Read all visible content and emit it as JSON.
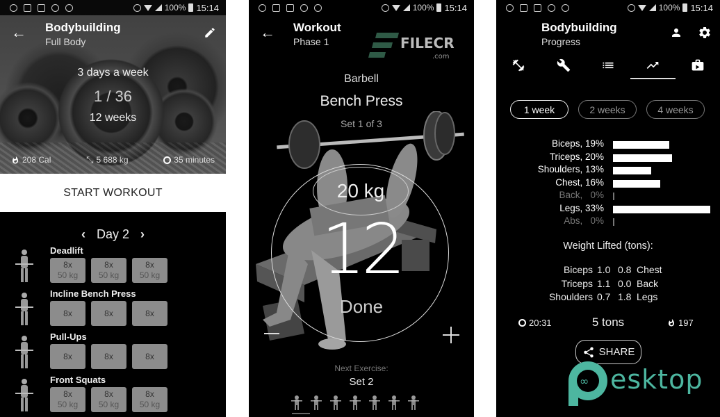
{
  "status_bar": {
    "battery": "100%",
    "time": "15:14"
  },
  "panel_overview": {
    "title": "Bodybuilding",
    "subtitle": "Full Body",
    "frequency": "3 days a week",
    "progress": "1 / 36",
    "duration": "12 weeks",
    "stats": {
      "calories": "208 Cal",
      "weight": "5 688 kg",
      "time": "35 minutes"
    },
    "start_label": "START WORKOUT",
    "day_label": "Day 2",
    "exercises": [
      {
        "name": "Deadlift",
        "sets": [
          {
            "reps": "8x",
            "weight": "50 kg"
          },
          {
            "reps": "8x",
            "weight": "50 kg"
          },
          {
            "reps": "8x",
            "weight": "50 kg"
          }
        ]
      },
      {
        "name": "Incline Bench Press",
        "sets": [
          {
            "reps": "8x",
            "weight": ""
          },
          {
            "reps": "8x",
            "weight": ""
          },
          {
            "reps": "8x",
            "weight": ""
          }
        ]
      },
      {
        "name": "Pull-Ups",
        "sets": [
          {
            "reps": "8x",
            "weight": ""
          },
          {
            "reps": "8x",
            "weight": ""
          },
          {
            "reps": "8x",
            "weight": ""
          }
        ]
      },
      {
        "name": "Front Squats",
        "sets": [
          {
            "reps": "8x",
            "weight": "50 kg"
          },
          {
            "reps": "8x",
            "weight": "50 kg"
          },
          {
            "reps": "8x",
            "weight": "50 kg"
          }
        ]
      }
    ]
  },
  "panel_workout": {
    "title": "Workout",
    "subtitle": "Phase 1",
    "watermark": "FILECR",
    "watermark_sub": ".com",
    "equipment": "Barbell",
    "exercise": "Bench Press",
    "set_info": "Set 1 of 3",
    "weight": "20 kg",
    "reps": "12",
    "done_label": "Done",
    "next_label": "Next Exercise:",
    "next_value": "Set 2",
    "strip_count": 7
  },
  "panel_progress": {
    "title": "Bodybuilding",
    "subtitle": "Progress",
    "tabs": [
      "exercises-icon",
      "tools-icon",
      "list-icon",
      "trending-icon",
      "store-icon"
    ],
    "active_tab": 3,
    "ranges": [
      {
        "label": "1 week",
        "active": true
      },
      {
        "label": "2 weeks",
        "active": false
      },
      {
        "label": "4 weeks",
        "active": false
      }
    ],
    "muscle_split": [
      {
        "label": "Biceps, 19%",
        "value": 19
      },
      {
        "label": "Triceps, 20%",
        "value": 20
      },
      {
        "label": "Shoulders, 13%",
        "value": 13
      },
      {
        "label": "Chest, 16%",
        "value": 16
      },
      {
        "label": "Back,   0%",
        "value": 0
      },
      {
        "label": "Legs, 33%",
        "value": 33
      },
      {
        "label": "Abs,   0%",
        "value": 0
      }
    ],
    "weight_title": "Weight Lifted (tons):",
    "weight_rows": [
      {
        "left_name": "Biceps",
        "left_val": "1.0",
        "right_val": "0.8",
        "right_name": "Chest"
      },
      {
        "left_name": "Triceps",
        "left_val": "1.1",
        "right_val": "0.0",
        "right_name": "Back"
      },
      {
        "left_name": "Shoulders",
        "left_val": "0.7",
        "right_val": "1.8",
        "right_name": "Legs"
      }
    ],
    "total_time": "20:31",
    "total_tons": "5 tons",
    "total_cal": "197",
    "share_label": "SHARE",
    "watermark": "esktop",
    "watermark_color": "#4db6a0"
  }
}
